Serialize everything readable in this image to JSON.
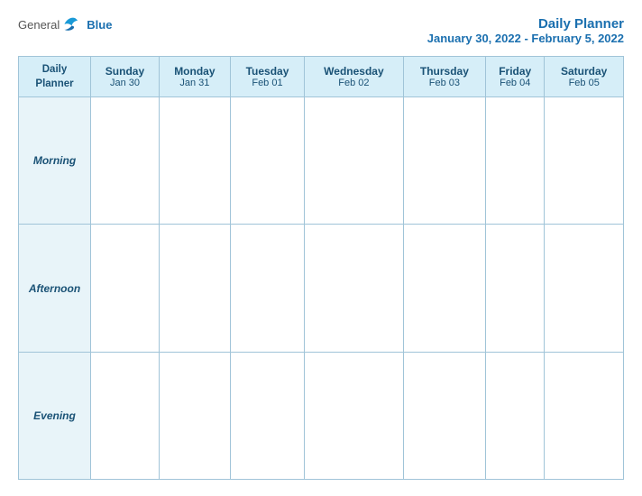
{
  "header": {
    "logo": {
      "general": "General",
      "blue": "Blue"
    },
    "title": "Daily Planner",
    "date_range": "January 30, 2022 - February 5, 2022"
  },
  "table": {
    "first_col_label": "Daily Planner",
    "columns": [
      {
        "day": "Sunday",
        "date": "Jan 30"
      },
      {
        "day": "Monday",
        "date": "Jan 31"
      },
      {
        "day": "Tuesday",
        "date": "Feb 01"
      },
      {
        "day": "Wednesday",
        "date": "Feb 02"
      },
      {
        "day": "Thursday",
        "date": "Feb 03"
      },
      {
        "day": "Friday",
        "date": "Feb 04"
      },
      {
        "day": "Saturday",
        "date": "Feb 05"
      }
    ],
    "rows": [
      {
        "label": "Morning"
      },
      {
        "label": "Afternoon"
      },
      {
        "label": "Evening"
      }
    ]
  }
}
